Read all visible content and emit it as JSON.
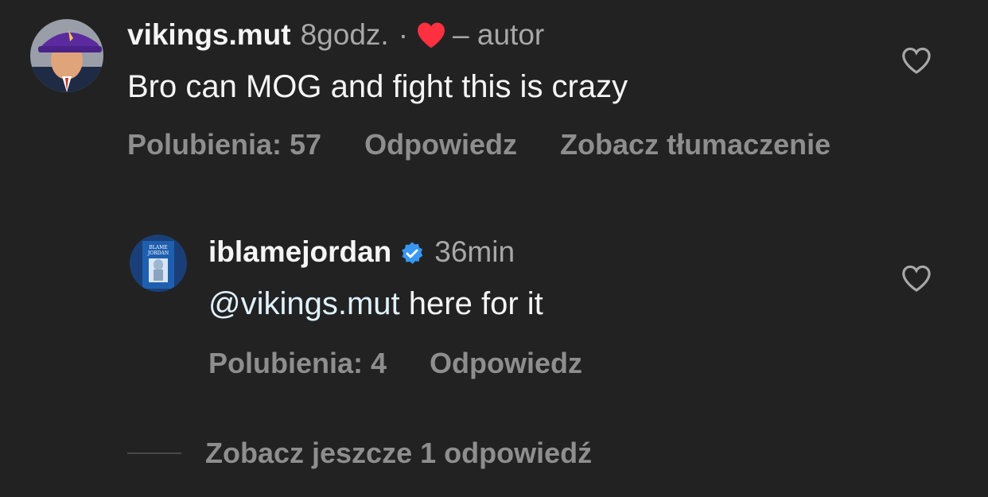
{
  "comments": [
    {
      "username": "vikings.mut",
      "time": "8godz.",
      "separator": "·",
      "author_label": "– autor",
      "text": "Bro can MOG and fight this is crazy",
      "likes_label": "Polubienia: 57",
      "reply_label": "Odpowiedz",
      "translate_label": "Zobacz tłumaczenie"
    },
    {
      "username": "iblamejordan",
      "time": "36min",
      "mention": "@vikings.mut",
      "text": " here for it",
      "likes_label": "Polubienia: 4",
      "reply_label": "Odpowiedz",
      "avatar_text": "I BLAME JORDAN"
    }
  ],
  "more_replies_label": "Zobacz jeszcze 1 odpowiedź",
  "colors": {
    "background": "#222222",
    "liked_heart": "#ff3040",
    "verified": "#3897f0",
    "mention": "#e0f1ff"
  },
  "icons": {
    "like": "heart-outline-icon",
    "liked_by_author": "heart-filled-icon",
    "verified": "verified-badge-icon"
  }
}
